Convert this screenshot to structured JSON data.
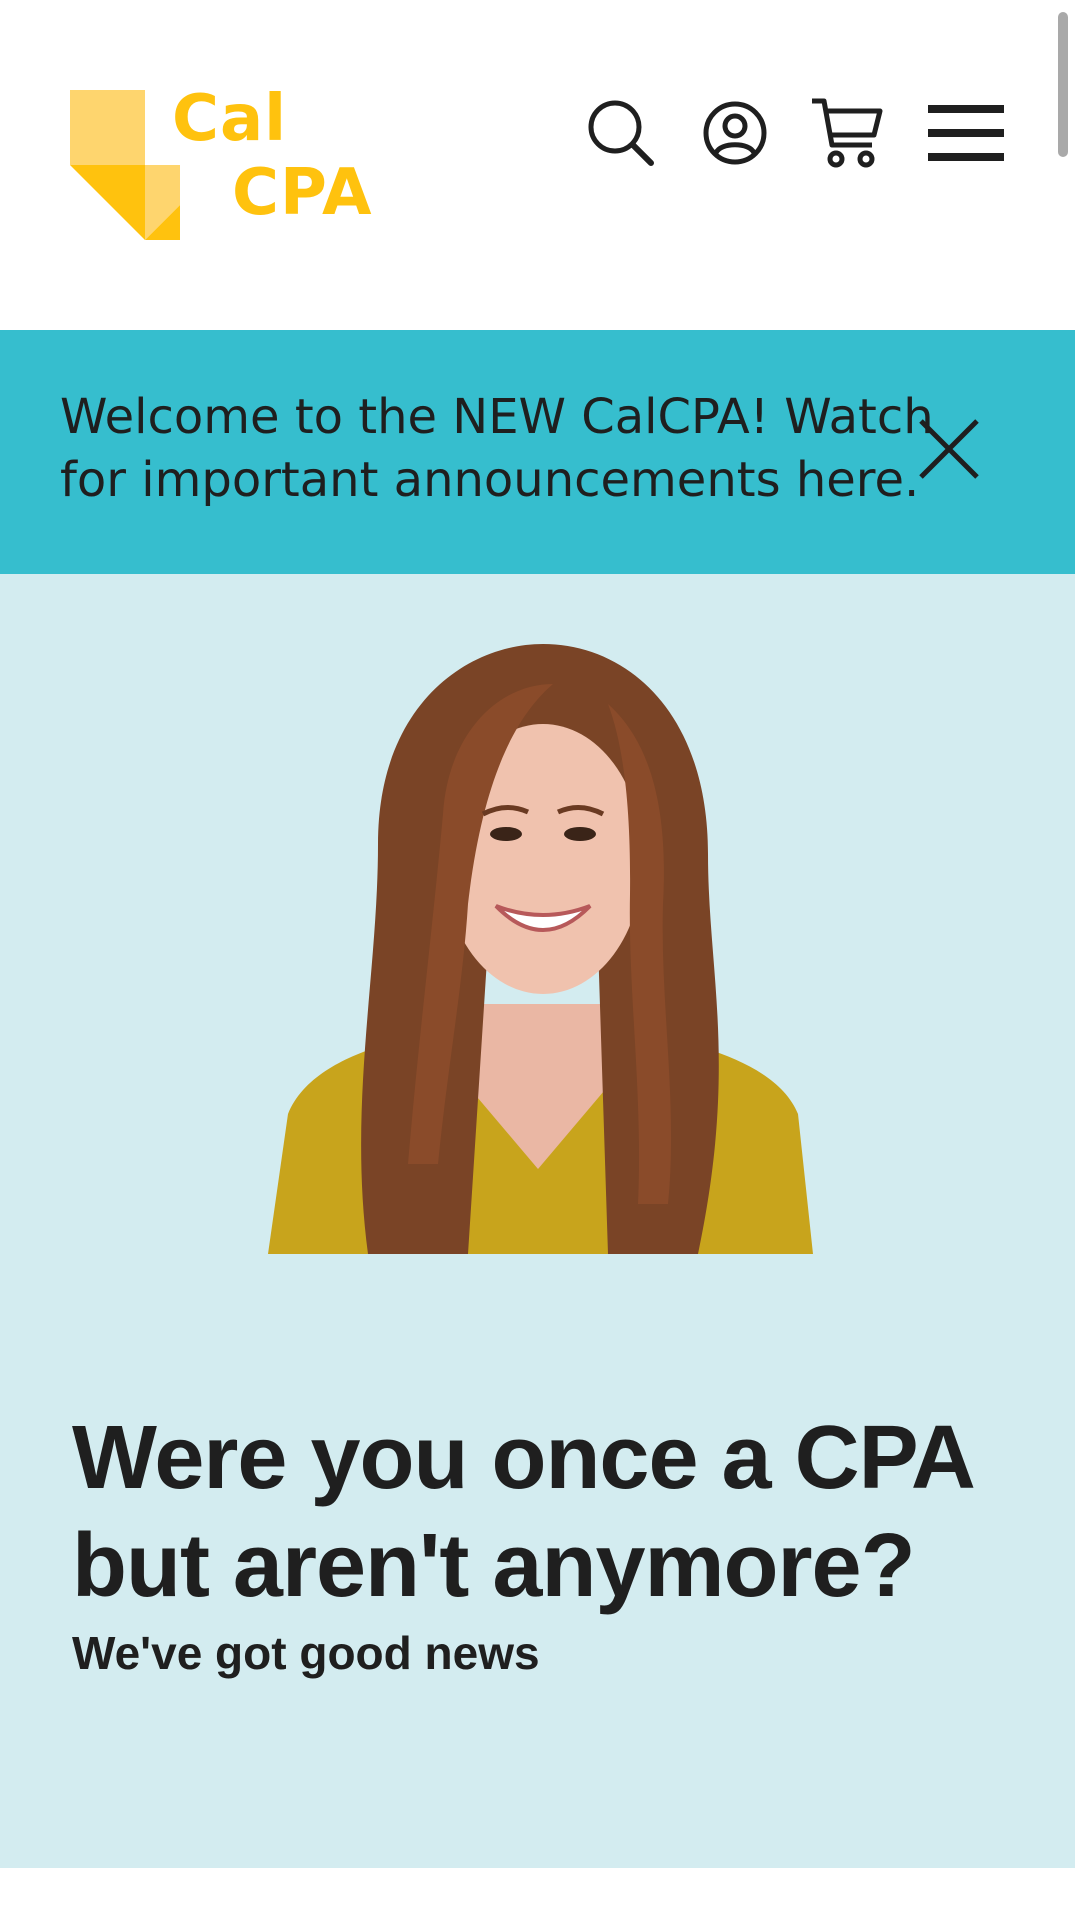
{
  "brand": {
    "logo_line1": "Cal",
    "logo_line2": "CPA",
    "logo_color": "#ffc20e"
  },
  "header": {
    "icons": [
      "search-icon",
      "account-icon",
      "cart-icon",
      "menu-icon"
    ]
  },
  "announcement": {
    "text": "Welcome to the NEW CalCPA! Watch for important announcements here.",
    "background": "#36bece",
    "close_icon": "close-icon"
  },
  "hero": {
    "title": "Were you once a CPA but aren't anymore?",
    "subtitle": "We've got good news",
    "background": "#d3ecf0"
  }
}
